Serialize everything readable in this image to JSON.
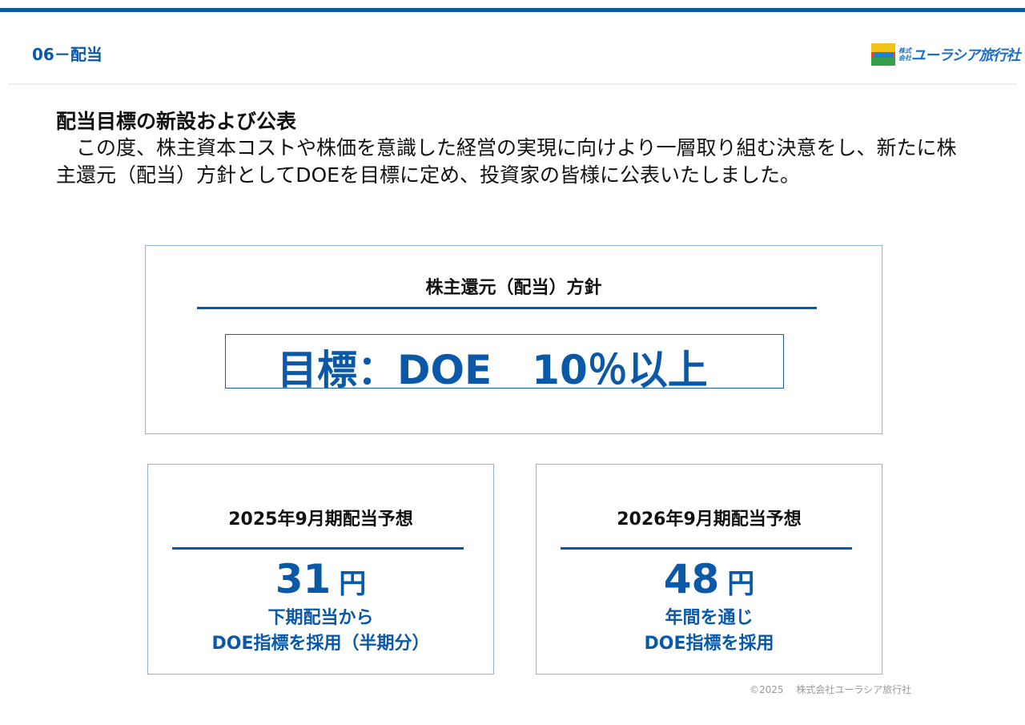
{
  "header": {
    "section_title": "06－配当",
    "logo": {
      "kabushiki": "株式",
      "kaisha": "会社",
      "name": "ユーラシア旅行社"
    }
  },
  "intro": {
    "heading": "配当目標の新設および公表",
    "body": "　この度、株主資本コストや株価を意識した経営の実現に向けより一層取り組む決意をし、新たに株主還元（配当）方針としてDOEを目標に定め、投資家の皆様に公表いたしました。"
  },
  "policy": {
    "title": "株主還元（配当）方針",
    "target": "目標：DOE　10％以上"
  },
  "forecasts": [
    {
      "title": "2025年9月期配当予想",
      "value": "31",
      "unit": "円",
      "note_line1": "下期配当から",
      "note_line2": "DOE指標を採用（半期分）"
    },
    {
      "title": "2026年9月期配当予想",
      "value": "48",
      "unit": "円",
      "note_line1": "年間を通じ",
      "note_line2": "DOE指標を採用"
    }
  ],
  "footer": {
    "copyright": "©2025　 株式会社ユーラシア旅行社"
  },
  "colors": {
    "accent": "#0a58a8",
    "border": "#8fb3d4"
  }
}
